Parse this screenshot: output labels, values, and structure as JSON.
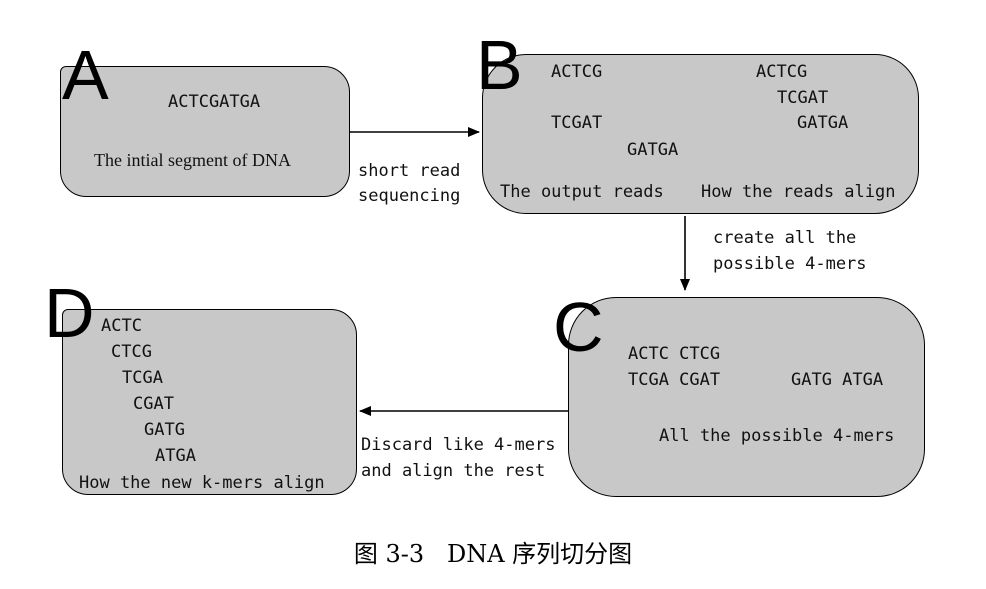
{
  "panels": {
    "A": {
      "letter": "A",
      "sequence": "ACTCGATGA",
      "caption": "The intial segment of DNA"
    },
    "B": {
      "letter": "B",
      "output_reads": [
        "ACTCG",
        "TCGAT",
        "GATGA"
      ],
      "aligned_reads": [
        "ACTCG",
        "TCGAT",
        "GATGA"
      ],
      "caption_left": "The output reads",
      "caption_right": "How the reads align"
    },
    "C": {
      "letter": "C",
      "row1": "ACTC CTCG",
      "row2_left": "TCGA CGAT",
      "row2_right": "GATG ATGA",
      "caption": "All the possible 4-mers"
    },
    "D": {
      "letter": "D",
      "kmers": [
        "ACTC",
        "CTCG",
        "TCGA",
        "CGAT",
        "GATG",
        "ATGA"
      ],
      "caption": "How the new k-mers align"
    }
  },
  "arrows": {
    "a_to_b": {
      "line1": "short read",
      "line2": "sequencing"
    },
    "b_to_c": {
      "line1": "create all the",
      "line2": "possible 4-mers"
    },
    "c_to_d": {
      "line1": "Discard like 4-mers",
      "line2": "and align the rest"
    }
  },
  "figure_caption": "图 3-3   DNA 序列切分图"
}
